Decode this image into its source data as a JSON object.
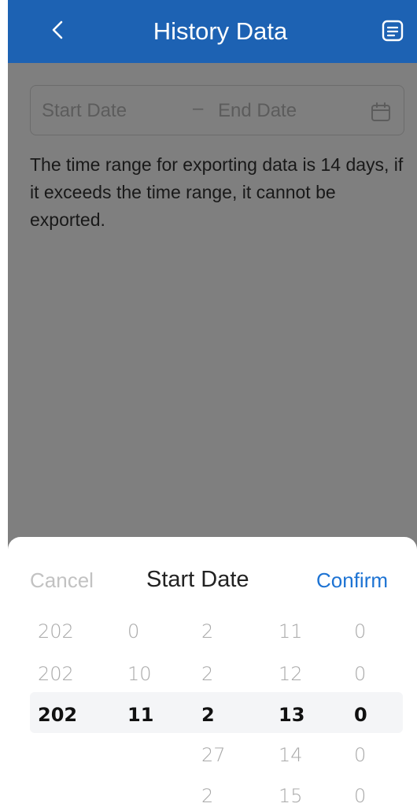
{
  "header": {
    "title": "History Data",
    "back_icon": "chevron-left-icon",
    "menu_icon": "list-document-icon"
  },
  "date_range": {
    "start_placeholder": "Start Date",
    "separator": "–",
    "end_placeholder": "End Date",
    "icon": "calendar-icon"
  },
  "hint": "The time range for exporting data is 14 days, if it exceeds the time range, it cannot be exported.",
  "picker": {
    "cancel_label": "Cancel",
    "title": "Start Date",
    "confirm_label": "Confirm",
    "columns": [
      {
        "name": "year",
        "items": [
          "202",
          "202",
          "202",
          "",
          ""
        ],
        "selected_index": 2
      },
      {
        "name": "month",
        "items": [
          "0",
          "10",
          "11",
          "",
          ""
        ],
        "selected_index": 2
      },
      {
        "name": "day",
        "items": [
          "2",
          "2",
          "2",
          "27",
          "2"
        ],
        "selected_index": 2
      },
      {
        "name": "hour",
        "items": [
          "11",
          "12",
          "13",
          "14",
          "15"
        ],
        "selected_index": 2
      },
      {
        "name": "minute",
        "items": [
          "0",
          "0",
          "0",
          "0",
          "0"
        ],
        "selected_index": 2
      }
    ]
  },
  "colors": {
    "header_bg": "#1d62b3",
    "confirm": "#1d73d3",
    "overlay": "rgba(0,0,0,0.5)"
  }
}
